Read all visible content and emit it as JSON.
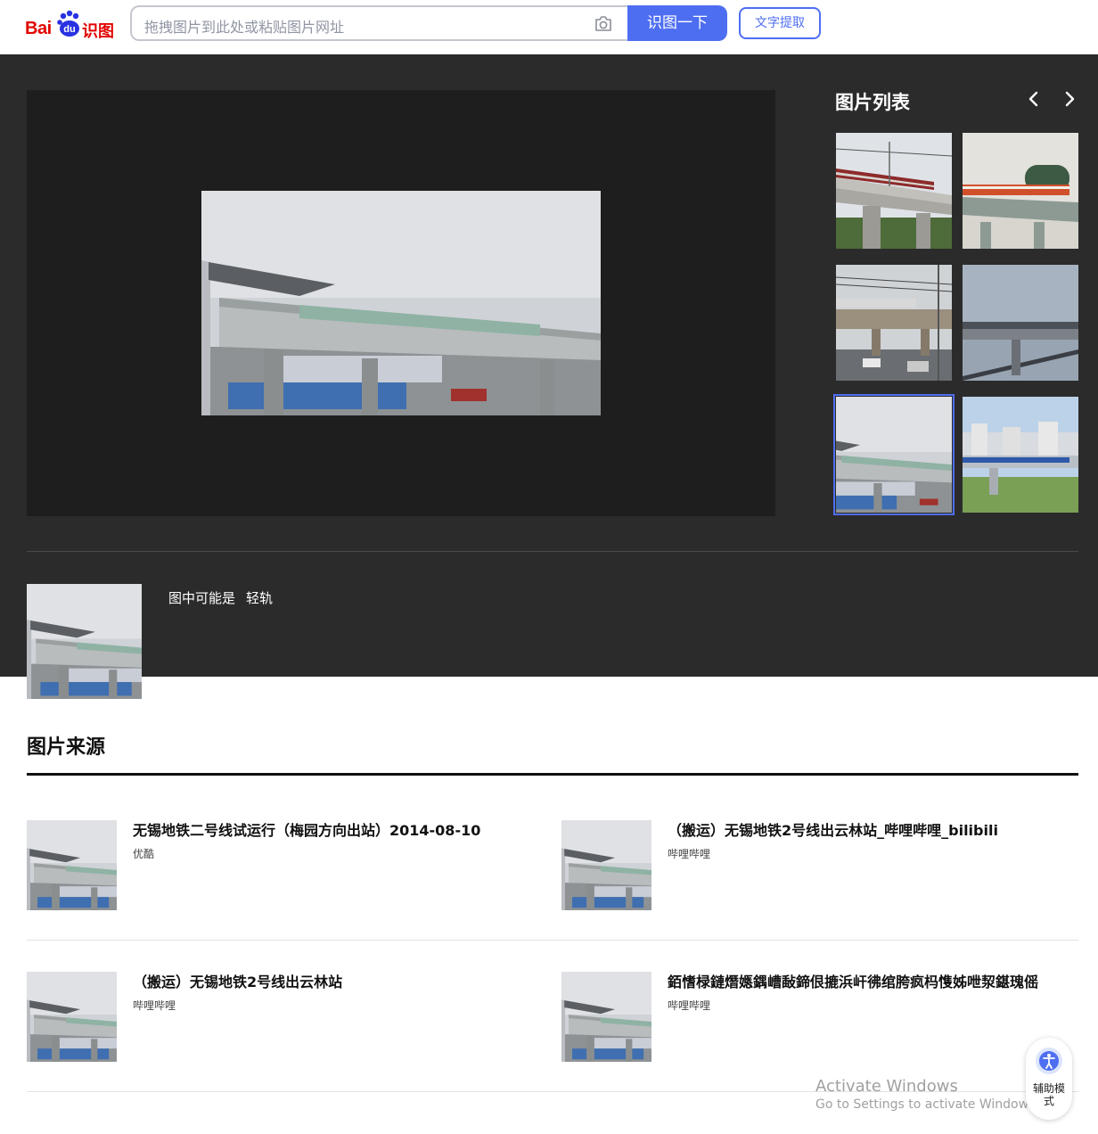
{
  "header": {
    "logo_text_left": "Bai",
    "logo_text_paw": "du",
    "logo_text_right": "识图",
    "search_placeholder": "拖拽图片到此处或粘贴图片网址",
    "search_button": "识图一下",
    "ocr_button": "文字提取"
  },
  "viewer": {
    "list_title": "图片列表",
    "thumbnails": [
      {
        "variant": "viaduct-red"
      },
      {
        "variant": "station-canopy"
      },
      {
        "variant": "street-bridge"
      },
      {
        "variant": "overcast-viaduct"
      },
      {
        "variant": "query-gray",
        "selected": true
      },
      {
        "variant": "city-towers"
      }
    ]
  },
  "guess": {
    "prefix": "图中可能是",
    "label": "轻轨"
  },
  "sources": {
    "title": "图片来源",
    "items": [
      {
        "title": "无锡地铁二号线试运行（梅园方向出站）2014-08-10",
        "site": "优酷"
      },
      {
        "title": "（搬运）无锡地铁2号线出云林站_哔哩哔哩_bilibili",
        "site": "哔哩哔哩"
      },
      {
        "title": "（搬运）无锡地铁2号线出云林站",
        "site": "哔哩哔哩"
      },
      {
        "title": "銆愭椂鏈熸嫕鍝嶆敮鍗佷摝浜屽彿绾胯疯杩愯姊呭洯鍖瑰傜",
        "site": "哔哩哔哩"
      }
    ]
  },
  "overlay": {
    "activate_title": "Activate Windows",
    "activate_sub": "Go to Settings to activate Windows.",
    "assist_label": "辅助模式"
  },
  "colors": {
    "brand_red": "#e10601",
    "accent_blue": "#4e6ef2",
    "dark_bg": "#2b2b2b",
    "stage_bg": "#1e1e1e"
  },
  "icons": [
    "camera-icon",
    "chevron-left-icon",
    "chevron-right-icon",
    "accessibility-icon",
    "paw-logo-icon"
  ]
}
